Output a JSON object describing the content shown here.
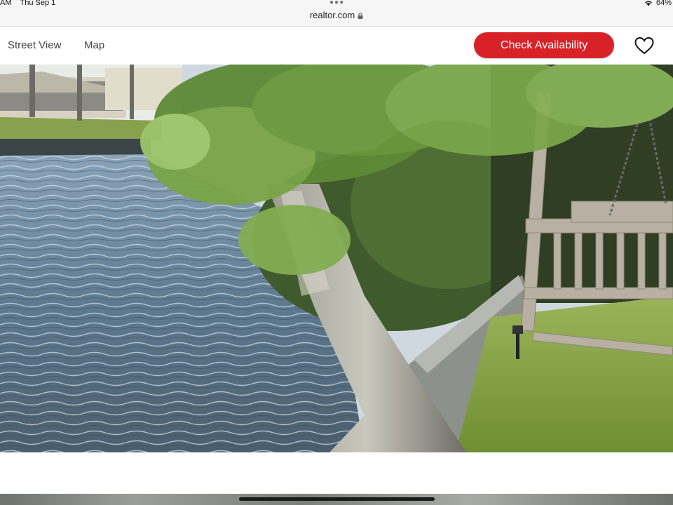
{
  "status_bar": {
    "time": "AM",
    "date": "Thu Sep 1",
    "url": "realtor.com",
    "battery": "64%"
  },
  "nav": {
    "street_view": "Street View",
    "map": "Map",
    "check_availability": "Check Availability"
  },
  "icons": {
    "lock": "lock-icon",
    "wifi": "wifi-icon",
    "favorite": "heart-icon",
    "more": "more-dots-icon"
  },
  "colors": {
    "accent": "#d92228",
    "water": "#6f8aa0",
    "grass": "#7fa03e"
  },
  "photo": {
    "subject": "waterfront canal with tree, seawall and wooden swing"
  }
}
